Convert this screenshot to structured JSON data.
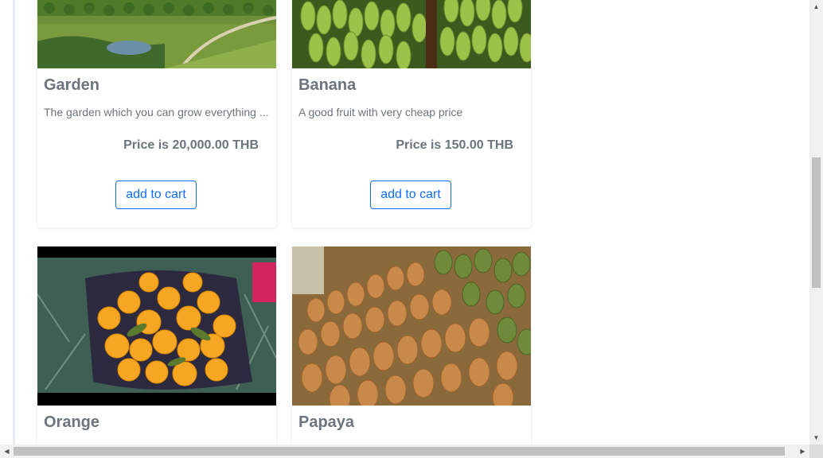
{
  "products": [
    {
      "title": "Garden",
      "description": "The garden which you can grow everything ...",
      "price": "Price is 20,000.00 THB",
      "button_label": "add to cart",
      "image": "garden-orchard-photo"
    },
    {
      "title": "Banana",
      "description": "A good fruit with very cheap price",
      "price": "Price is 150.00 THB",
      "button_label": "add to cart",
      "image": "banana-bunch-photo"
    },
    {
      "title": "Orange",
      "image": "oranges-basket-photo"
    },
    {
      "title": "Papaya",
      "image": "papaya-pile-photo"
    }
  ],
  "colors": {
    "accent": "#0d6efd",
    "text": "#6c757d",
    "scrollbar_track": "#f1f1f1",
    "scrollbar_thumb": "#c1c1c1"
  }
}
